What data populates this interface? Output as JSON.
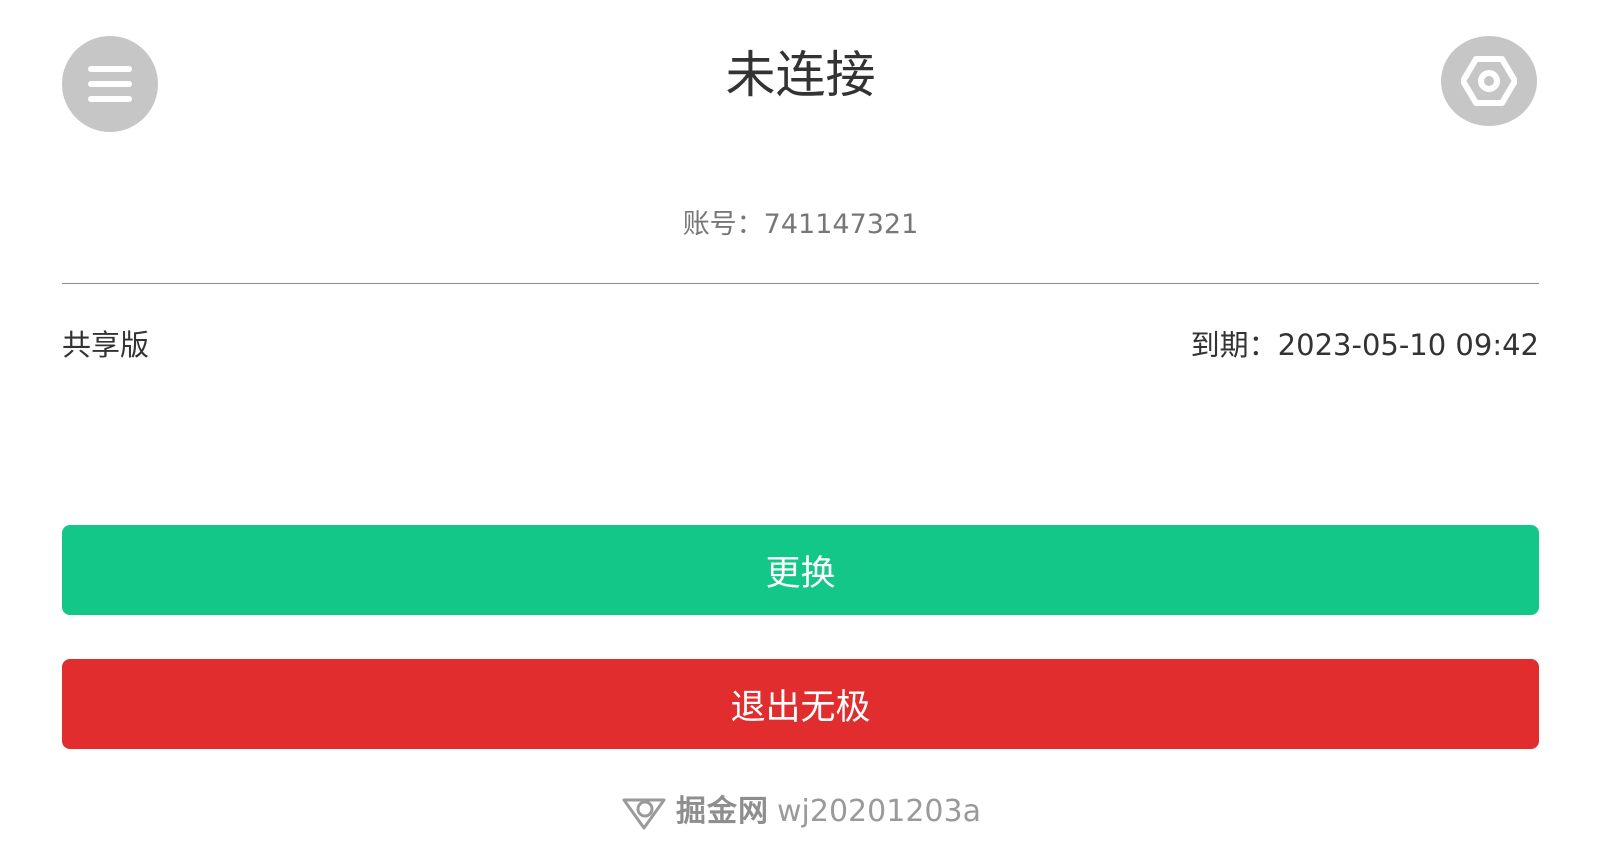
{
  "header": {
    "title": "未连接",
    "menu_icon": "hamburger-menu-icon",
    "settings_icon": "hex-nut-settings-icon"
  },
  "account": {
    "text": "账号：741147321"
  },
  "plan": {
    "edition": "共享版",
    "expiry": "到期：2023-05-10 09:42"
  },
  "actions": {
    "change_label": "更换",
    "exit_label": "退出无极"
  },
  "watermark": {
    "brand": "掘金网",
    "id": "wj20201203a"
  },
  "colors": {
    "change_button": "#12c787",
    "exit_button": "#e12d2e",
    "icon_circle": "#c6c6c6"
  }
}
